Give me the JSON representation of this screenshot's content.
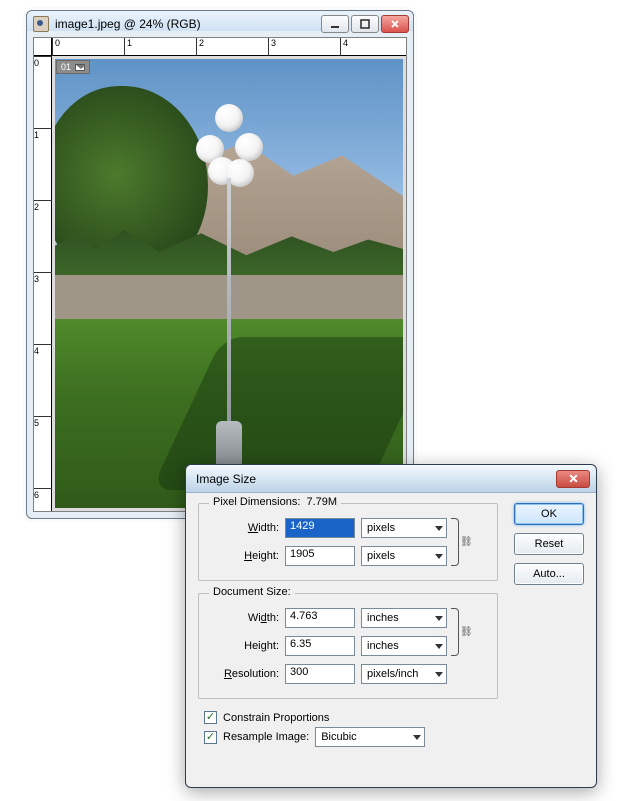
{
  "image_window": {
    "title": "image1.jpeg @ 24% (RGB)",
    "info_tag": "01",
    "ruler_h": [
      "0",
      "1",
      "2",
      "3",
      "4"
    ],
    "ruler_v": [
      "0",
      "1",
      "2",
      "3",
      "4",
      "5",
      "6"
    ]
  },
  "dialog": {
    "title": "Image Size",
    "pixel_dimensions": {
      "legend": "Pixel Dimensions:",
      "size_text": "7.79M",
      "width_label": "Width:",
      "width_value": "1429",
      "width_unit": "pixels",
      "height_label": "Height:",
      "height_value": "1905",
      "height_unit": "pixels"
    },
    "document_size": {
      "legend": "Document Size:",
      "width_label": "Width:",
      "width_value": "4.763",
      "width_unit": "inches",
      "height_label": "Height:",
      "height_value": "6.35",
      "height_unit": "inches",
      "resolution_label": "Resolution:",
      "resolution_value": "300",
      "resolution_unit": "pixels/inch"
    },
    "constrain_label": "Constrain Proportions",
    "resample_label": "Resample Image:",
    "resample_method": "Bicubic",
    "buttons": {
      "ok": "OK",
      "reset": "Reset",
      "auto": "Auto..."
    }
  }
}
